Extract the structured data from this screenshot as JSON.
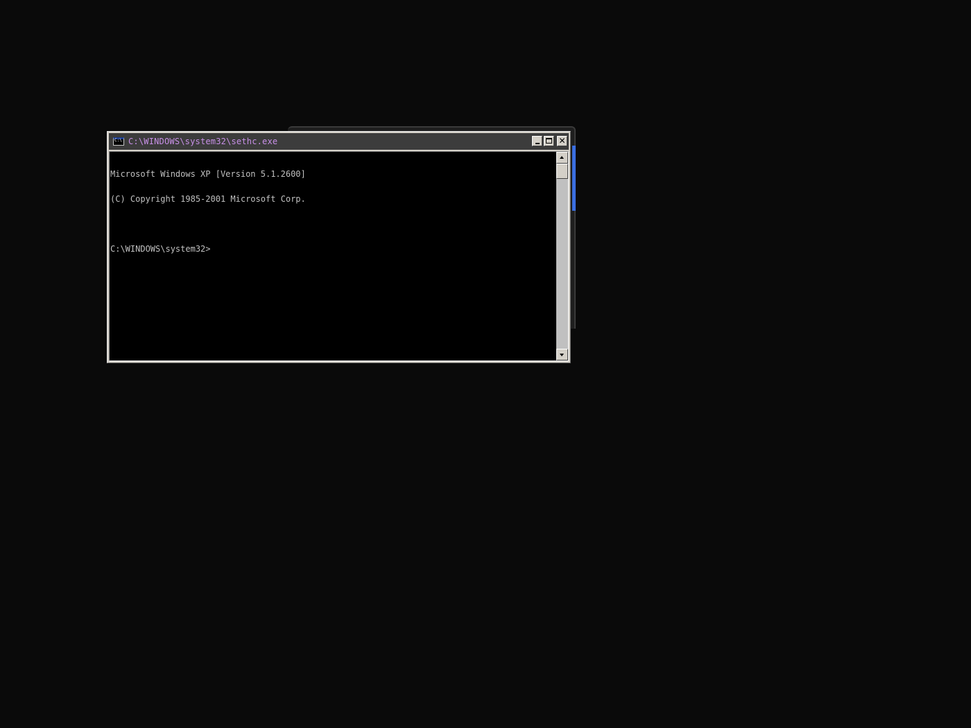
{
  "window": {
    "title": "C:\\WINDOWS\\system32\\sethc.exe",
    "icon": "console-icon",
    "buttons": {
      "minimize": "minimize-icon",
      "maximize": "maximize-icon",
      "close": "close-icon"
    }
  },
  "terminal": {
    "lines": [
      "Microsoft Windows XP [Version 5.1.2600]",
      "(C) Copyright 1985-2001 Microsoft Corp.",
      "",
      "C:\\WINDOWS\\system32>"
    ],
    "text_color": "#c0c0c0",
    "background_color": "#000000"
  },
  "colors": {
    "title_text": "#c890e8",
    "titlebar": "#3c3c3c",
    "desktop": "#0a0a0a",
    "frame": "#d4d0c8"
  }
}
